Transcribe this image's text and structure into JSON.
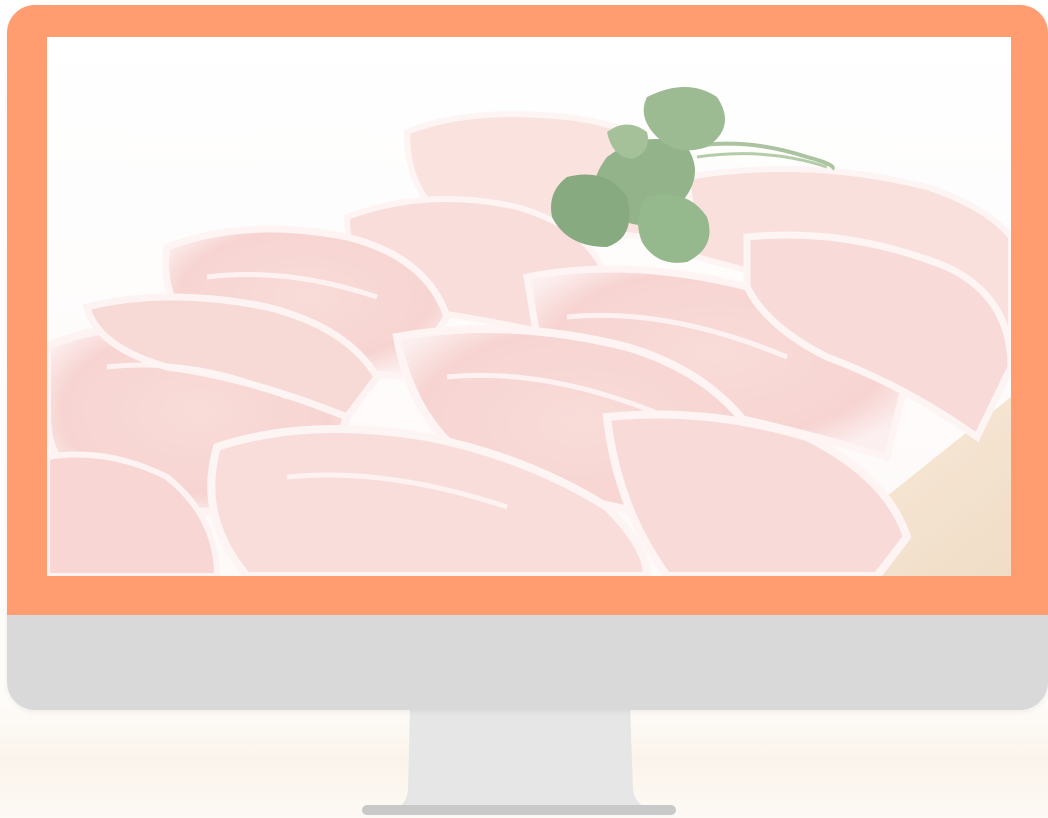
{
  "monitor": {
    "bezel_color": "#ff9c70",
    "chin_color": "#d9d9d9",
    "stand_color": "#e6e6e6",
    "base_color": "#c9c9c9"
  },
  "screen": {
    "image": {
      "icon": "raw-pork-chops-photo",
      "colors": {
        "meat": "#f6cdc9",
        "fat": "#fbeeee",
        "parsley": "#6f9a64",
        "board": "#f1dcc2"
      }
    }
  }
}
